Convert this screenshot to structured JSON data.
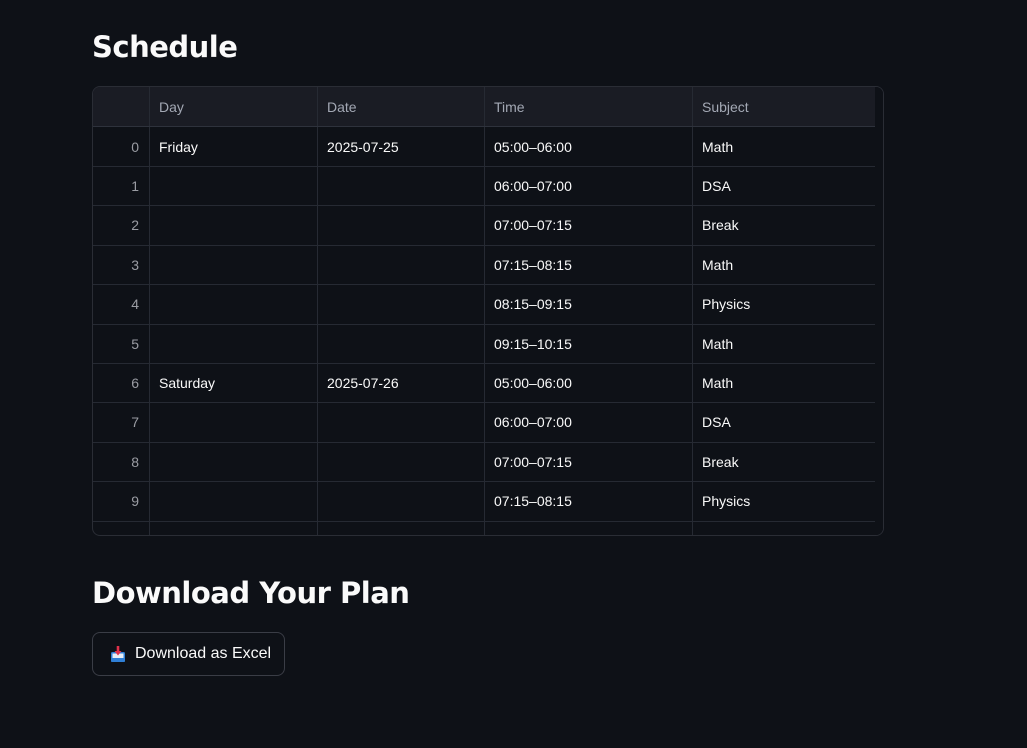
{
  "schedule_heading": "Schedule",
  "download_heading": "Download Your Plan",
  "table": {
    "columns": [
      "",
      "Day",
      "Date",
      "Time",
      "Subject"
    ],
    "rows": [
      {
        "index": "0",
        "day": "Friday",
        "date": "2025-07-25",
        "time": "05:00–06:00",
        "subject": "Math"
      },
      {
        "index": "1",
        "day": "",
        "date": "",
        "time": "06:00–07:00",
        "subject": "DSA"
      },
      {
        "index": "2",
        "day": "",
        "date": "",
        "time": "07:00–07:15",
        "subject": "Break"
      },
      {
        "index": "3",
        "day": "",
        "date": "",
        "time": "07:15–08:15",
        "subject": "Math"
      },
      {
        "index": "4",
        "day": "",
        "date": "",
        "time": "08:15–09:15",
        "subject": "Physics"
      },
      {
        "index": "5",
        "day": "",
        "date": "",
        "time": "09:15–10:15",
        "subject": "Math"
      },
      {
        "index": "6",
        "day": "Saturday",
        "date": "2025-07-26",
        "time": "05:00–06:00",
        "subject": "Math"
      },
      {
        "index": "7",
        "day": "",
        "date": "",
        "time": "06:00–07:00",
        "subject": "DSA"
      },
      {
        "index": "8",
        "day": "",
        "date": "",
        "time": "07:00–07:15",
        "subject": "Break"
      },
      {
        "index": "9",
        "day": "",
        "date": "",
        "time": "07:15–08:15",
        "subject": "Physics"
      }
    ]
  },
  "download_button": {
    "label": "Download as Excel",
    "icon": "inbox-tray-icon"
  },
  "colors": {
    "background": "#0e1117",
    "text": "#fafafa",
    "header_bg": "#1a1c24",
    "border": "#262a33"
  }
}
